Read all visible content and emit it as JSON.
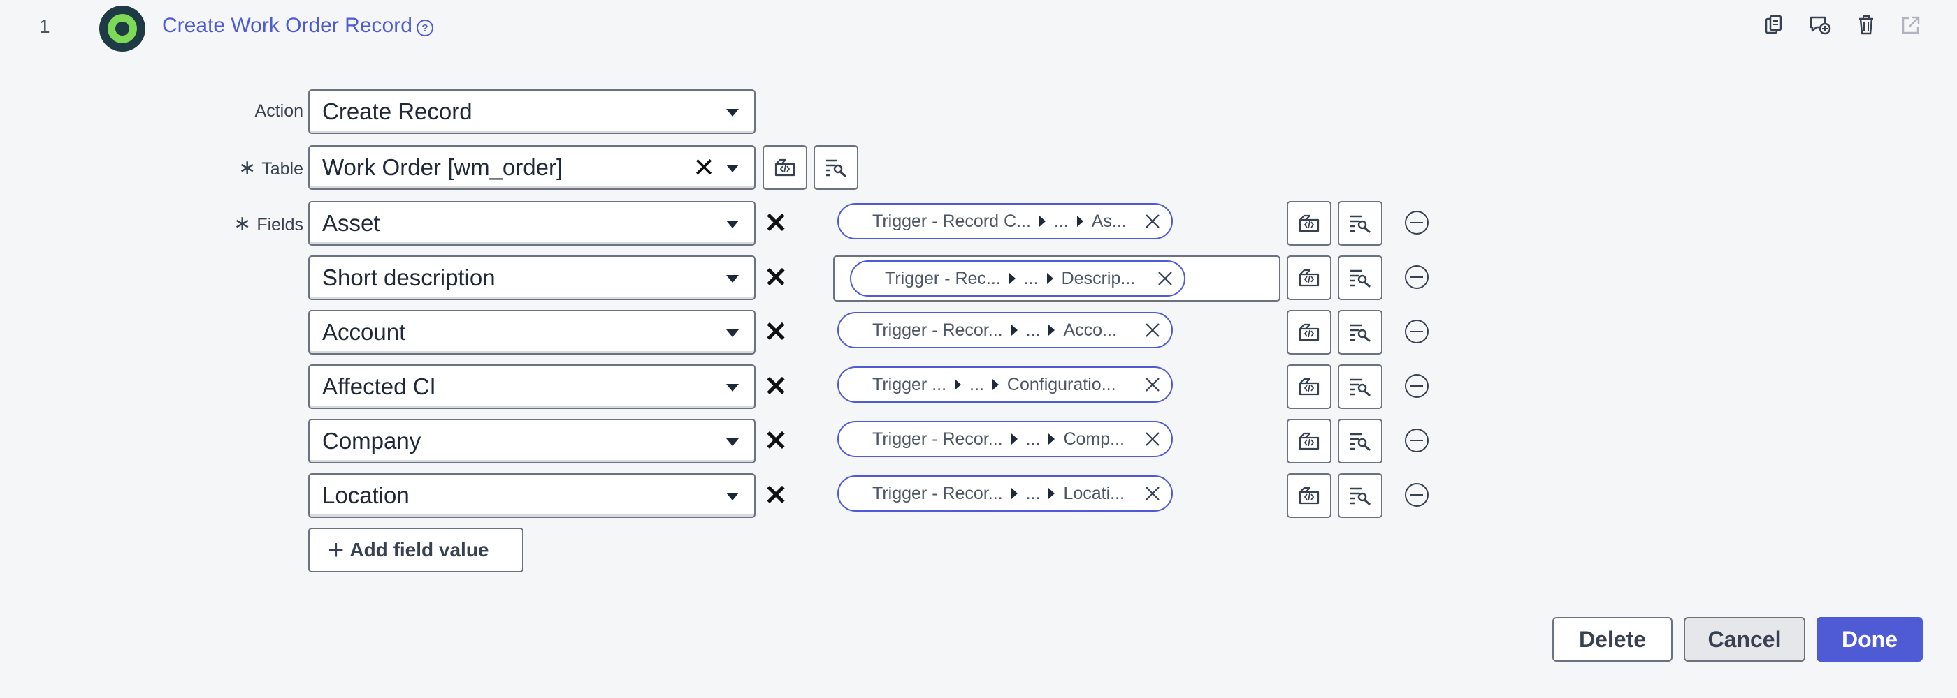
{
  "header": {
    "step_number": "1",
    "title": "Create Work Order Record",
    "help_icon": "?"
  },
  "form": {
    "action_label": "Action",
    "action_value": "Create Record",
    "table_label": "Table",
    "table_value": "Work Order [wm_order]",
    "fields_label": "Fields",
    "required_mark": "∗",
    "clear_mark": "✕"
  },
  "fields": [
    {
      "name": "Asset",
      "pill": [
        "Trigger - Record C...",
        "...",
        "As..."
      ]
    },
    {
      "name": "Short description",
      "pill": [
        "Trigger - Rec...",
        "...",
        "Descrip..."
      ]
    },
    {
      "name": "Account",
      "pill": [
        "Trigger - Recor...",
        "...",
        "Acco..."
      ]
    },
    {
      "name": "Affected CI",
      "pill": [
        "Trigger ...",
        "...",
        "Configuratio..."
      ]
    },
    {
      "name": "Company",
      "pill": [
        "Trigger - Recor...",
        "...",
        "Comp..."
      ]
    },
    {
      "name": "Location",
      "pill": [
        "Trigger - Recor...",
        "...",
        "Locati..."
      ]
    }
  ],
  "add_field_label": "Add field value",
  "footer": {
    "delete_label": "Delete",
    "cancel_label": "Cancel",
    "done_label": "Done"
  },
  "colors": {
    "accent": "#4f5bd5",
    "flow_icon_ring": "#7ed957"
  }
}
